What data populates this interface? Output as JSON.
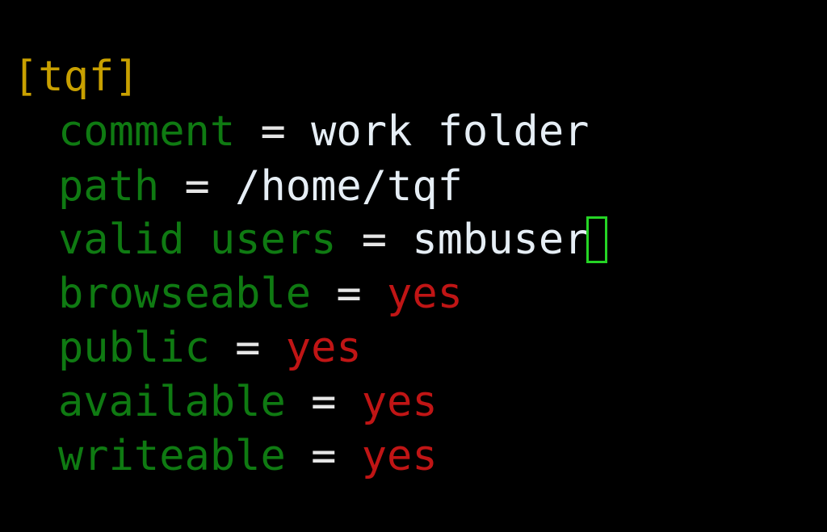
{
  "editor": {
    "section_header": "[tqf]",
    "lines": [
      {
        "key": "comment",
        "op": "=",
        "value": "work folder",
        "value_type": "string"
      },
      {
        "key": "path",
        "op": "=",
        "value": "/home/tqf",
        "value_type": "string"
      },
      {
        "key": "valid users",
        "op": "=",
        "value": "smbuser",
        "value_type": "string"
      },
      {
        "key": "browseable",
        "op": "=",
        "value": "yes",
        "value_type": "boolean"
      },
      {
        "key": "public",
        "op": "=",
        "value": "yes",
        "value_type": "boolean"
      },
      {
        "key": "available",
        "op": "=",
        "value": "yes",
        "value_type": "boolean"
      },
      {
        "key": "writeable",
        "op": "=",
        "value": "yes",
        "value_type": "boolean"
      }
    ],
    "colors": {
      "background": "#000000",
      "section": "#c8a000",
      "key": "#0f7a12",
      "operator": "#e6e6e6",
      "string_value": "#e6eef5",
      "boolean_value": "#c01515",
      "cursor": "#25d425"
    }
  }
}
